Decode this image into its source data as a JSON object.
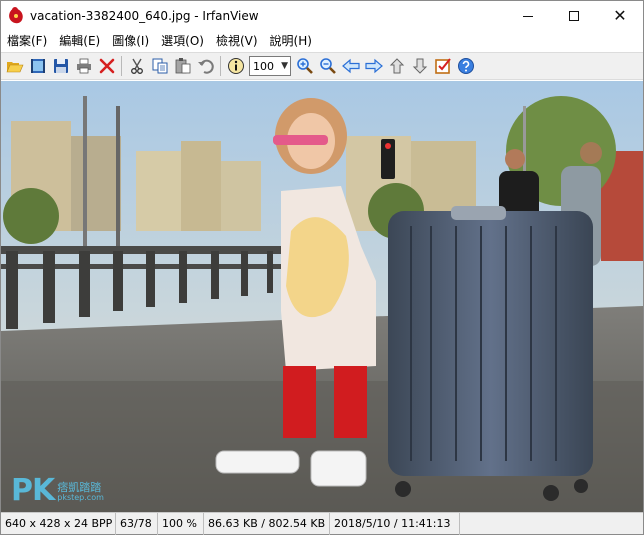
{
  "window": {
    "title": "vacation-3382400_640.jpg - IrfanView"
  },
  "menu": {
    "items": [
      {
        "label": "檔案(F)"
      },
      {
        "label": "編輯(E)"
      },
      {
        "label": "圖像(I)"
      },
      {
        "label": "選項(O)"
      },
      {
        "label": "檢視(V)"
      },
      {
        "label": "說明(H)"
      }
    ]
  },
  "toolbar": {
    "zoom_value": "100",
    "icons": [
      "open-icon",
      "slideshow-icon",
      "save-icon",
      "print-icon",
      "delete-icon",
      "cut-icon",
      "copy-icon",
      "paste-icon",
      "undo-icon",
      "info-icon",
      "zoom-in-icon",
      "zoom-out-icon",
      "previous-icon",
      "next-icon",
      "first-page-icon",
      "last-page-icon",
      "options-icon",
      "help-icon"
    ]
  },
  "image": {
    "watermark_brand": "PK",
    "watermark_text": "痞凱踏踏",
    "watermark_sub": "pkstep.com"
  },
  "statusbar": {
    "dimensions": "640 x 428 x 24 BPP",
    "index": "63/78",
    "zoom": "100 %",
    "size": "86.63 KB / 802.54 KB",
    "datetime": "2018/5/10 / 11:41:13"
  },
  "colors": {
    "accent_blue": "#2b6fd6",
    "delete_red": "#d62020",
    "watermark": "#59b8d8",
    "suitcase": "#4c5a6b"
  }
}
